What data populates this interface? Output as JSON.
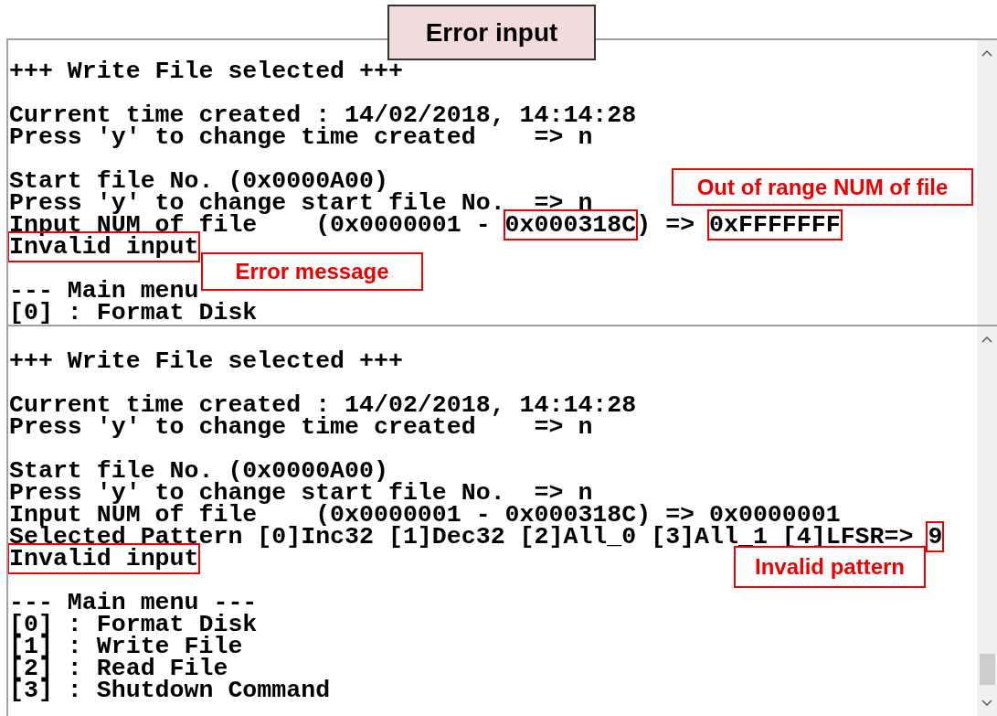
{
  "title": "Error input",
  "panels": [
    {
      "lines": [
        {
          "kind": "text",
          "segments": [
            {
              "text": "+++ Write File selected +++",
              "boxed": false
            }
          ]
        },
        {
          "kind": "blank"
        },
        {
          "kind": "text",
          "segments": [
            {
              "text": "Current time created : 14/02/2018, 14:14:28",
              "boxed": false
            }
          ]
        },
        {
          "kind": "text",
          "segments": [
            {
              "text": "Press 'y' to change time created    => n",
              "boxed": false
            }
          ]
        },
        {
          "kind": "blank"
        },
        {
          "kind": "text",
          "segments": [
            {
              "text": "Start file No. (0x0000A00)",
              "boxed": false
            }
          ]
        },
        {
          "kind": "text",
          "segments": [
            {
              "text": "Press 'y' to change start file No.  => n",
              "boxed": false
            }
          ]
        },
        {
          "kind": "text",
          "segments": [
            {
              "text": "Input NUM of file    (0x0000001 - ",
              "boxed": false
            },
            {
              "text": "0x000318C",
              "boxed": true
            },
            {
              "text": ") => ",
              "boxed": false
            },
            {
              "text": "0xFFFFFFF",
              "boxed": true
            }
          ]
        },
        {
          "kind": "text",
          "segments": [
            {
              "text": "Invalid input",
              "boxed": true
            }
          ]
        },
        {
          "kind": "blank"
        },
        {
          "kind": "text",
          "segments": [
            {
              "text": "--- Main menu",
              "boxed": false
            }
          ]
        },
        {
          "kind": "text",
          "segments": [
            {
              "text": "[0] : Format Disk",
              "boxed": false
            }
          ]
        }
      ],
      "callouts": [
        {
          "text": "Out of range NUM of file",
          "kind": "range"
        },
        {
          "text": "Error message",
          "kind": "message"
        }
      ],
      "scroll_down": false
    },
    {
      "lines": [
        {
          "kind": "text",
          "segments": [
            {
              "text": "+++ Write File selected +++",
              "boxed": false
            }
          ]
        },
        {
          "kind": "blank"
        },
        {
          "kind": "text",
          "segments": [
            {
              "text": "Current time created : 14/02/2018, 14:14:28",
              "boxed": false
            }
          ]
        },
        {
          "kind": "text",
          "segments": [
            {
              "text": "Press 'y' to change time created    => n",
              "boxed": false
            }
          ]
        },
        {
          "kind": "blank"
        },
        {
          "kind": "text",
          "segments": [
            {
              "text": "Start file No. (0x0000A00)",
              "boxed": false
            }
          ]
        },
        {
          "kind": "text",
          "segments": [
            {
              "text": "Press 'y' to change start file No.  => n",
              "boxed": false
            }
          ]
        },
        {
          "kind": "text",
          "segments": [
            {
              "text": "Input NUM of file    (0x0000001 - 0x000318C) => 0x0000001",
              "boxed": false
            }
          ]
        },
        {
          "kind": "text",
          "segments": [
            {
              "text": "Selected Pattern [0]Inc32 [1]Dec32 [2]All_0 [3]All_1 [4]LFSR=> ",
              "boxed": false
            },
            {
              "text": "9",
              "boxed": true
            }
          ]
        },
        {
          "kind": "text",
          "segments": [
            {
              "text": "Invalid input",
              "boxed": true
            }
          ]
        },
        {
          "kind": "blank"
        },
        {
          "kind": "text",
          "segments": [
            {
              "text": "--- Main menu ---",
              "boxed": false
            }
          ]
        },
        {
          "kind": "text",
          "segments": [
            {
              "text": "[0] : Format Disk",
              "boxed": false
            }
          ]
        },
        {
          "kind": "text",
          "segments": [
            {
              "text": "[1] : Write File",
              "boxed": false
            }
          ]
        },
        {
          "kind": "text",
          "segments": [
            {
              "text": "[2] : Read File",
              "boxed": false
            }
          ]
        },
        {
          "kind": "text",
          "segments": [
            {
              "text": "[3] : Shutdown Command",
              "boxed": false
            }
          ]
        }
      ],
      "callouts": [
        {
          "text": "Invalid pattern",
          "kind": "pattern"
        }
      ],
      "scroll_down": true
    }
  ]
}
